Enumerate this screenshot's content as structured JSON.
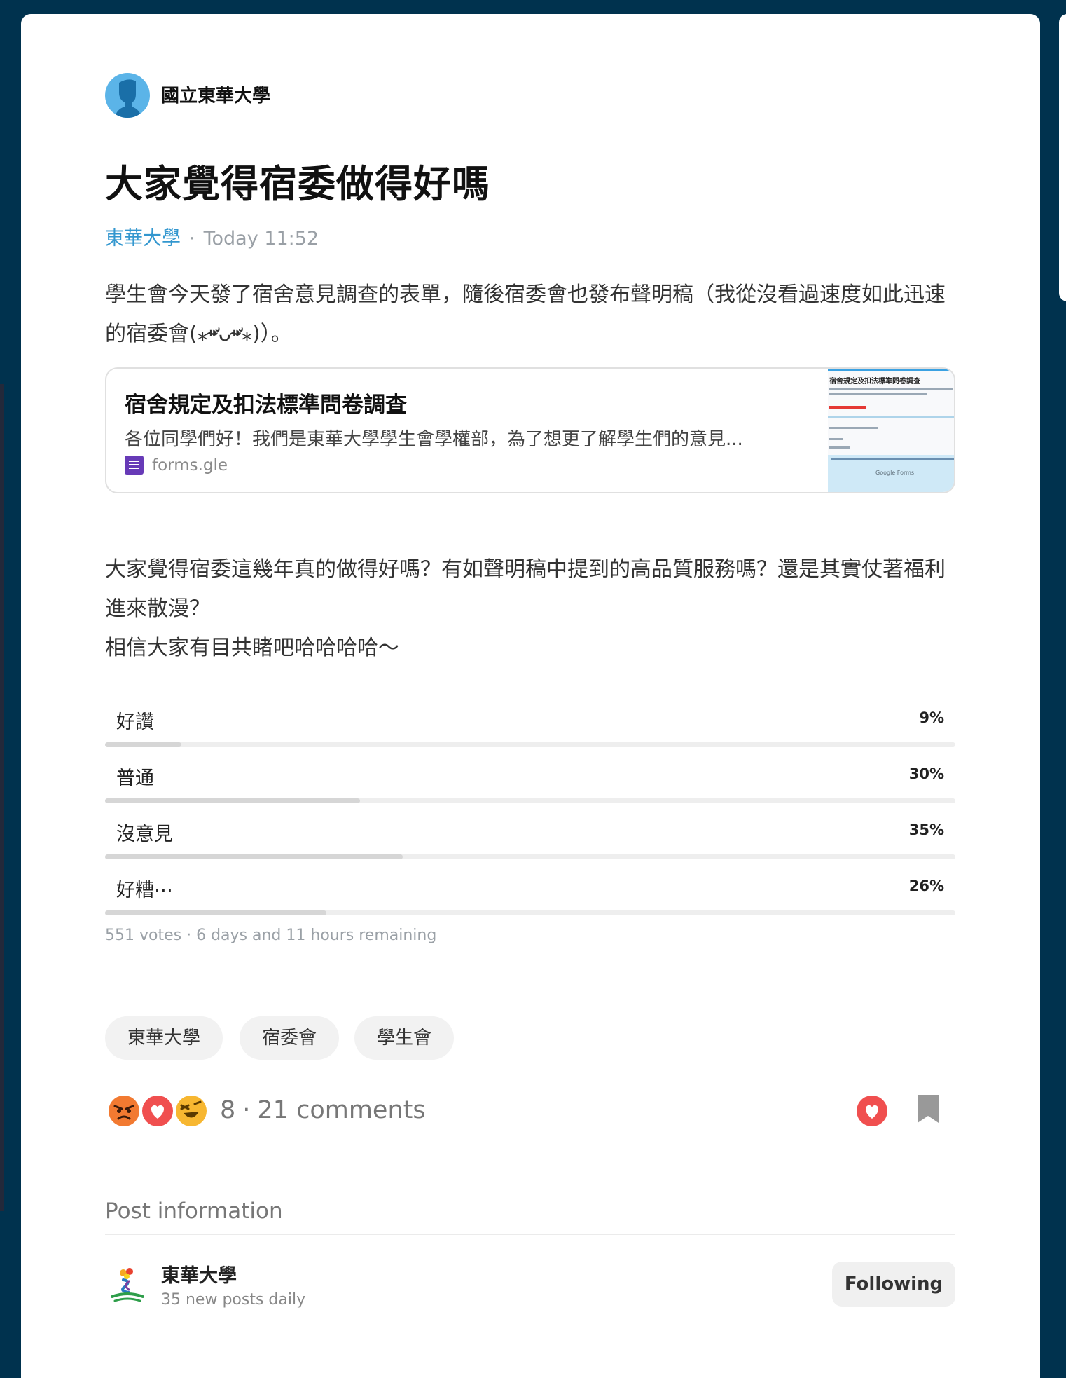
{
  "author": {
    "name": "國立東華大學"
  },
  "post": {
    "title": "大家覺得宿委做得好嗎",
    "forum": "東華大學",
    "time": "Today 11:52",
    "paragraph1": "學生會今天發了宿舍意見調查的表單，隨後宿委會也發布聲明稿（我從沒看過速度如此迅速的宿委會(⁎⁍̴̛ᴗ⁍̴̛⁎)）。",
    "paragraph2_lines": [
      "大家覺得宿委這幾年真的做得好嗎？有如聲明稿中提到的高品質服務嗎？還是其實仗著福利進來散漫？",
      "相信大家有目共睹吧哈哈哈哈～"
    ]
  },
  "link_card": {
    "title": "宿舍規定及扣法標準問卷調查",
    "description": "各位同學們好！我們是東華大學學生會學權部，為了想更了解學生們的意見...",
    "source": "forms.gle",
    "thumb_title": "宿舍規定及扣法標準問卷調查",
    "thumb_footer": "Google Forms",
    "icon": "google-forms-icon"
  },
  "poll": {
    "options": [
      {
        "label": "好讚",
        "percent": 9
      },
      {
        "label": "普通",
        "percent": 30
      },
      {
        "label": "沒意見",
        "percent": 35
      },
      {
        "label": "好糟⋯",
        "percent": 26
      }
    ],
    "votes": "551 votes",
    "remaining": "6 days and 11 hours remaining"
  },
  "tags": [
    "東華大學",
    "宿委會",
    "學生會"
  ],
  "engagement": {
    "reaction_icons": [
      "angry-face-icon",
      "heart-icon",
      "laughing-face-icon"
    ],
    "reaction_count": "8",
    "comments": "21 comments"
  },
  "post_info": {
    "heading": "Post information",
    "forum_name": "東華大學",
    "forum_sub": "35 new posts daily",
    "follow_label": "Following"
  },
  "colors": {
    "background": "#00324e",
    "accent_link": "#3397cf",
    "heart": "#f04f4f",
    "forms_purple": "#673ab7"
  }
}
